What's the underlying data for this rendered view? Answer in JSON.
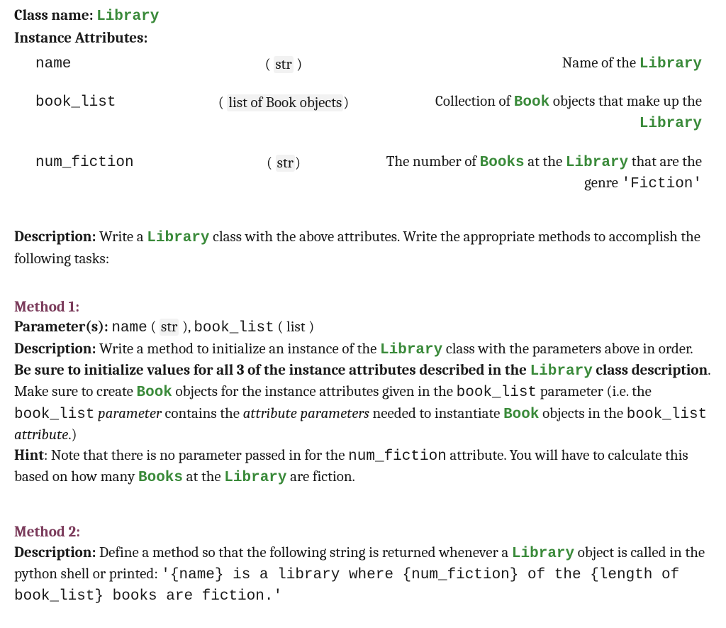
{
  "header": {
    "class_label": "Class name: ",
    "class_name": "Library",
    "attrs_label": "Instance Attributes:"
  },
  "attrs": [
    {
      "name": "name",
      "type_pre": "( ",
      "type_box": "str",
      "type_post": " )",
      "desc_pre": "Name of the ",
      "desc_code": "Library",
      "desc_post": ""
    },
    {
      "name": "book_list",
      "type_pre": "( ",
      "type_box": "list of Book objects",
      "type_post": ")",
      "desc_pre": "Collection of ",
      "desc_code": "Book",
      "desc_mid": " objects that make up the ",
      "desc_code2": "Library",
      "desc_post": ""
    },
    {
      "name": "num_fiction",
      "type_pre": "( ",
      "type_box": "str",
      "type_post": ")",
      "desc_pre": "The number of ",
      "desc_code": "Books",
      "desc_mid": " at the ",
      "desc_code2": "Library",
      "desc_post2": " that are the genre ",
      "desc_mono": "'Fiction'"
    }
  ],
  "description": {
    "label": "Description:",
    "text1": "  Write a ",
    "code1": "Library",
    "text2": " class with the above attributes. Write the appropriate methods to accomplish the following tasks:"
  },
  "method1": {
    "title": "Method 1:",
    "params_label": "Parameter(s): ",
    "p1_name": "name",
    "p1_pre": " ( ",
    "p1_box": "str",
    "p1_post": " ), ",
    "p2_name": "book_list",
    "p2_pre": " ( ",
    "p2_type": "list",
    "p2_post": " )",
    "desc_label": "Description: ",
    "d1": "Write a method to initialize an instance of the ",
    "d_code1": "Library",
    "d2": " class with the parameters above in order. ",
    "d_bold": "Be sure to initialize values for all 3 of the instance attributes described in the ",
    "d_bold_code": "Library",
    "d_bold2": " class description",
    "d3": ". Make sure to create  ",
    "d_code2": "Book",
    "d4": " objects for the instance attributes given in the ",
    "d_mono1": "book_list",
    "d5": " parameter (i.e. the ",
    "d_mono2": "book_list",
    "d6_ital": " parameter",
    "d7": " contains the ",
    "d8_ital": "attribute parameters",
    "d9": " needed to instantiate ",
    "d_code3": "Book",
    "d10": " objects in the ",
    "d_mono3": "book_list",
    "d11_ital": " attribute",
    "d12": ".)",
    "hint_label": "Hint",
    "h1": ": Note that there is no parameter passed in for the ",
    "h_mono1": "num_fiction",
    "h2": "  attribute. You will have to calculate this based on how many ",
    "h_code1": "Books",
    "h3": "   at the ",
    "h_code2": "Library",
    "h4": "  are fiction."
  },
  "method2": {
    "title": "Method 2:",
    "desc_label": "Description: ",
    "d1": "Define a method so that the following string is returned whenever a ",
    "d_code1": "Library",
    "d2": " object is called in the python shell or printed: ",
    "fmt": "'{name} is a library where {num_fiction} of the {length of book_list} books are fiction.'"
  }
}
